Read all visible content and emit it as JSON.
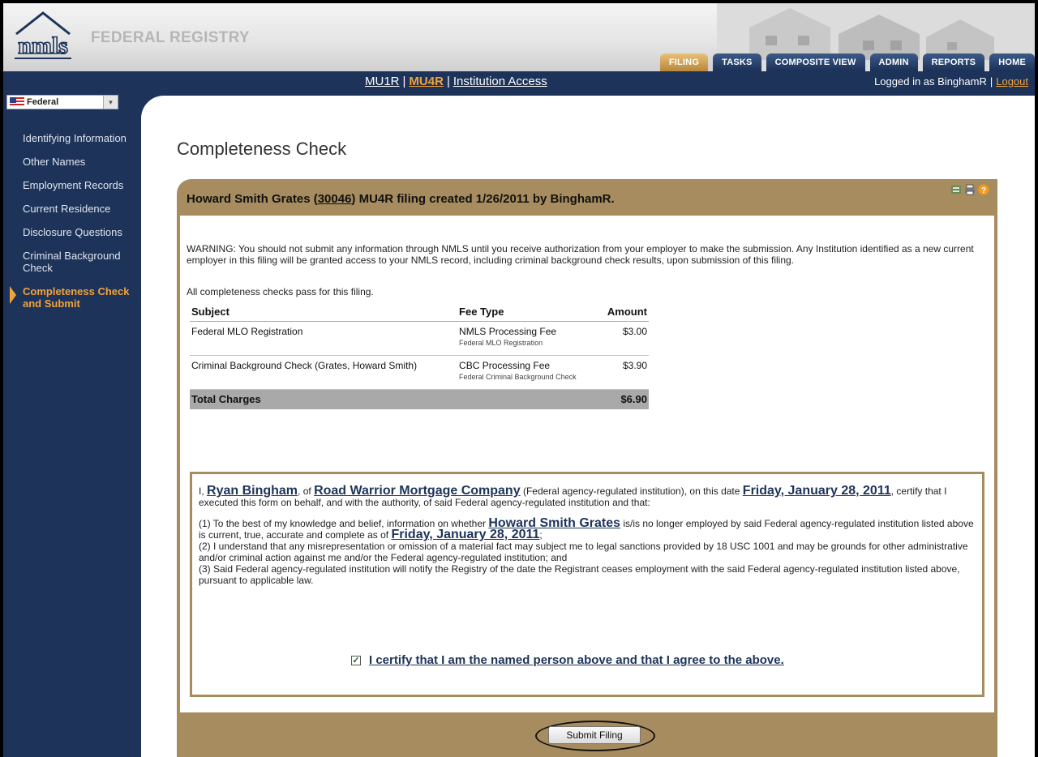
{
  "header": {
    "brand": "FEDERAL REGISTRY",
    "tabs": [
      {
        "label": "FILING",
        "active": true
      },
      {
        "label": "TASKS"
      },
      {
        "label": "COMPOSITE VIEW"
      },
      {
        "label": "ADMIN"
      },
      {
        "label": "REPORTS"
      },
      {
        "label": "HOME"
      }
    ]
  },
  "navbar": {
    "links": [
      "MU1R",
      "MU4R",
      "Institution Access"
    ],
    "logged_in": "Logged in as BinghamR",
    "logout": "Logout"
  },
  "sidebar": {
    "select_value": "Federal",
    "items": [
      {
        "label": "Identifying Information"
      },
      {
        "label": "Other Names"
      },
      {
        "label": "Employment Records"
      },
      {
        "label": "Current Residence"
      },
      {
        "label": "Disclosure Questions"
      },
      {
        "label": "Criminal Background Check"
      },
      {
        "label": "Completeness Check and Submit",
        "active": true
      }
    ]
  },
  "page": {
    "title": "Completeness Check",
    "panel_head_pre": "Howard Smith Grates (",
    "panel_head_id": "30046",
    "panel_head_post": ") MU4R filing created 1/26/2011 by BinghamR.",
    "warning": "WARNING: You should not submit any information through NMLS until you receive authorization from your employer to make the submission. Any Institution identified as a new current employer in this filing will be granted access to your NMLS record, including criminal background check results, upon submission of this filing.",
    "all_pass": "All completeness checks pass for this filing."
  },
  "fees": {
    "headers": [
      "Subject",
      "Fee Type",
      "Amount"
    ],
    "rows": [
      {
        "subject": "Federal MLO Registration",
        "fee": "NMLS Processing Fee",
        "fee_sub": "Federal MLO Registration",
        "amount": "$3.00"
      },
      {
        "subject": "Criminal Background Check (Grates, Howard Smith)",
        "fee": "CBC Processing Fee",
        "fee_sub": "Federal Criminal Background Check",
        "amount": "$3.90"
      }
    ],
    "total_label": "Total Charges",
    "total_amount": "$6.90"
  },
  "attestation": {
    "i": "I,",
    "name": "Ryan Bingham",
    "of": ", of",
    "company": "Road Warrior Mortgage Company",
    "after_company": "(Federal agency-regulated institution), on this date",
    "date": "Friday, January 28, 2011",
    "after_date": ", certify that I executed this form on behalf, and with the authority, of said Federal agency-regulated institution and that:",
    "p1_pre": "(1) To the best of my knowledge and belief, information on whether",
    "registrant": "Howard Smith Grates",
    "p1_mid": "is/is no longer employed by said Federal agency-regulated institution listed above is current, true, accurate and complete as of",
    "p1_date": "Friday, January 28, 2011",
    "p1_end": ";",
    "p2": "(2) I understand that any misrepresentation or omission of a material fact may subject me to legal sanctions provided by 18 USC 1001 and may be grounds for other administrative and/or criminal action against me and/or the Federal agency-regulated institution; and",
    "p3": "(3) Said Federal agency-regulated institution will notify the Registry of the date the Registrant ceases employment with the said Federal agency-regulated institution listed above, pursuant to applicable law.",
    "certify": "I certify that I am the named person above and that I agree to the above.",
    "certified": true
  },
  "submit_label": "Submit Filing"
}
